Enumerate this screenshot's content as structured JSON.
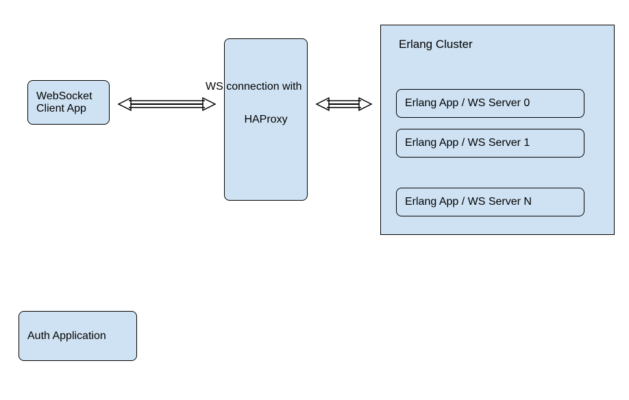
{
  "nodes": {
    "client": "WebSocket Client App",
    "haproxy": "HAProxy",
    "auth": "Auth Application",
    "cluster_title": "Erlang Cluster",
    "server0": "Erlang App / WS Server 0",
    "server1": "Erlang App / WS Server 1",
    "serverN": "Erlang App / WS Server N"
  },
  "edges": {
    "ws_connection": "WS connection with"
  }
}
